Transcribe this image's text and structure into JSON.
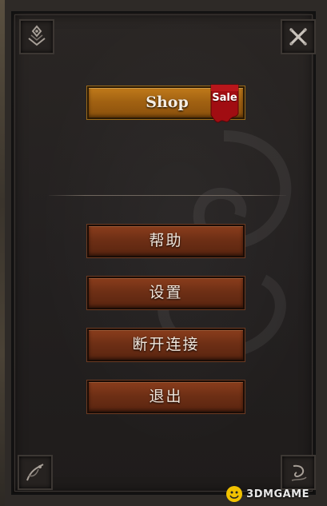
{
  "shop": {
    "label": "Shop",
    "badge": "Sale"
  },
  "menu": {
    "help": "帮助",
    "settings": "设置",
    "disconnect": "断开连接",
    "exit": "退出"
  },
  "watermark": {
    "text": "3DMGAME"
  },
  "icons": {
    "top_left": "ornament-icon",
    "close": "close-icon",
    "bottom_left": "ornament-icon",
    "bottom_right": "ornament-icon"
  },
  "colors": {
    "shop_button": "#a26212",
    "menu_button": "#6e2f15",
    "sale_badge": "#a10d12",
    "text": "#f0e6dc"
  }
}
